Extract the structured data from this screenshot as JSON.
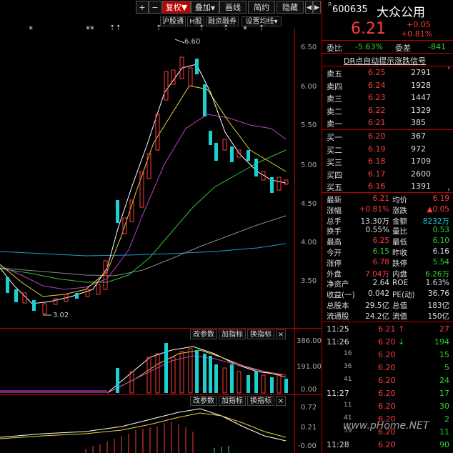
{
  "toolbar": {
    "plus": "+",
    "minus": "−",
    "fuquan": "复权",
    "diejia": "叠加",
    "huaxian": "画线",
    "jianyue": "简约",
    "yincang": "隐藏"
  },
  "subtoolbar": {
    "hugutong": "沪股通",
    "hgu": "H股",
    "rongzirongquan": "融资融券",
    "shezhijunxian": "设置均线"
  },
  "markers": {
    "star": "*",
    "star2": "**"
  },
  "price_axis": [
    "6.50",
    "6.00",
    "5.50",
    "5.00",
    "4.50",
    "4.00",
    "3.50"
  ],
  "chart_labels": {
    "high": "6.60",
    "low": "3.02"
  },
  "indicator_buttons": {
    "gaicanshu": "改参数",
    "jiazhibiao": "加指标",
    "huanzhibiao": "换指标",
    "close": "×"
  },
  "volume_axis": [
    "386.00",
    "191.00",
    "0.00"
  ],
  "macd_axis": [
    "0.72",
    "0.21",
    "-0.00"
  ],
  "watermark": "www.pHome.NET",
  "stock": {
    "r_mark": "R",
    "code": "600635",
    "name": "大众公用",
    "price": "6.21",
    "change": "+0.05",
    "change_pct": "+0.81%",
    "weibi_label": "委比",
    "weibi": "-5.63%",
    "weicha_label": "委差",
    "weicha": "-841",
    "signal_link": "DR点自动提示涨跌信号"
  },
  "orderbook": {
    "asks": [
      {
        "label": "卖五",
        "price": "6.25",
        "vol": "2791"
      },
      {
        "label": "卖四",
        "price": "6.24",
        "vol": "1928"
      },
      {
        "label": "卖三",
        "price": "6.23",
        "vol": "1447"
      },
      {
        "label": "卖二",
        "price": "6.22",
        "vol": "1329"
      },
      {
        "label": "卖一",
        "price": "6.21",
        "vol": "385"
      }
    ],
    "bids": [
      {
        "label": "买一",
        "price": "6.20",
        "vol": "367"
      },
      {
        "label": "买二",
        "price": "6.19",
        "vol": "972"
      },
      {
        "label": "买三",
        "price": "6.18",
        "vol": "1709"
      },
      {
        "label": "买四",
        "price": "6.17",
        "vol": "2600"
      },
      {
        "label": "买五",
        "price": "6.16",
        "vol": "1391"
      }
    ]
  },
  "quote": [
    {
      "l1": "最新",
      "v1": "6.21",
      "c1": "red",
      "l2": "均价",
      "v2": "6.19",
      "c2": "red"
    },
    {
      "l1": "涨幅",
      "v1": "+0.81%",
      "c1": "red",
      "l2": "涨跌",
      "v2": "▲0.05",
      "c2": "red"
    },
    {
      "l1": "总手",
      "v1": "13.30万",
      "c1": "white",
      "l2": "金额",
      "v2": "8232万",
      "c2": "cyan"
    },
    {
      "l1": "换手",
      "v1": "0.55%",
      "c1": "white",
      "l2": "量比",
      "v2": "0.53",
      "c2": "green"
    },
    {
      "l1": "最高",
      "v1": "6.25",
      "c1": "red",
      "l2": "最低",
      "v2": "6.10",
      "c2": "green"
    },
    {
      "l1": "今开",
      "v1": "6.15",
      "c1": "green",
      "l2": "昨收",
      "v2": "6.16",
      "c2": "white"
    },
    {
      "l1": "涨停",
      "v1": "6.78",
      "c1": "red",
      "l2": "跌停",
      "v2": "5.54",
      "c2": "green"
    },
    {
      "l1": "外盘",
      "v1": "7.04万",
      "c1": "red",
      "l2": "内盘",
      "v2": "6.26万",
      "c2": "green"
    },
    {
      "l1": "净资产",
      "v1": "2.64",
      "c1": "white",
      "l2": "ROE",
      "v2": "1.63%",
      "c2": "white"
    },
    {
      "l1": "收益(一)",
      "v1": "0.042",
      "c1": "white",
      "l2": "PE(动)",
      "v2": "36.76",
      "c2": "white"
    },
    {
      "l1": "总股本",
      "v1": "29.5亿",
      "c1": "white",
      "l2": "总值",
      "v2": "183亿",
      "c2": "white"
    },
    {
      "l1": "流通股",
      "v1": "24.2亿",
      "c1": "white",
      "l2": "流值",
      "v2": "150亿",
      "c2": "white"
    }
  ],
  "ticks": [
    {
      "t": "11:25",
      "p": "6.21",
      "arrow": "↑",
      "pc": "red",
      "v": "27",
      "vc": "red"
    },
    {
      "t": "11:26",
      "p": "6.20",
      "arrow": "↓",
      "pc": "red",
      "v": "194",
      "vc": "green"
    },
    {
      "t": "16",
      "p": "6.20",
      "arrow": "",
      "pc": "red",
      "v": "15",
      "vc": "green"
    },
    {
      "t": "36",
      "p": "6.20",
      "arrow": "",
      "pc": "red",
      "v": "5",
      "vc": "green"
    },
    {
      "t": "41",
      "p": "6.20",
      "arrow": "",
      "pc": "red",
      "v": "24",
      "vc": "green"
    },
    {
      "t": "11:27",
      "p": "6.20",
      "arrow": "",
      "pc": "red",
      "v": "17",
      "vc": "green"
    },
    {
      "t": "11",
      "p": "6.20",
      "arrow": "",
      "pc": "red",
      "v": "30",
      "vc": "green"
    },
    {
      "t": "41",
      "p": "6.20",
      "arrow": "",
      "pc": "red",
      "v": "2",
      "vc": "green"
    },
    {
      "t": "59",
      "p": "6.20",
      "arrow": "",
      "pc": "red",
      "v": "11",
      "vc": "green"
    },
    {
      "t": "11:28",
      "p": "6.20",
      "arrow": "",
      "pc": "red",
      "v": "90",
      "vc": "green"
    }
  ],
  "colors": {
    "up": "#ff3b3b",
    "down": "#1ecfd0",
    "border": "#b00000",
    "ma5": "#ffffff",
    "ma10": "#e6d23a",
    "ma20": "#c040c0",
    "ma30": "#2fc52f",
    "ma60": "#aaaaaa",
    "ma120": "#1e9bd0"
  }
}
